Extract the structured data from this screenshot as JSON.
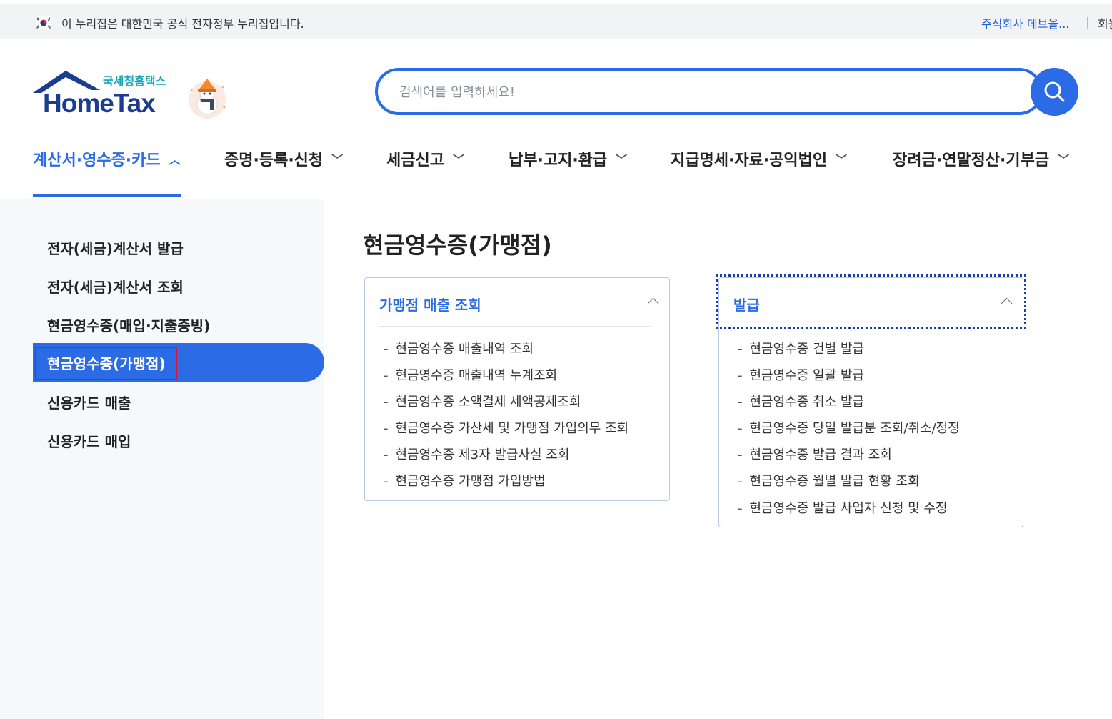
{
  "topbar": {
    "gov_notice": "이 누리집은 대한민국 공식 전자정부 누리집입니다.",
    "company": "주식회사 데브올...",
    "member": "회원"
  },
  "logo": {
    "sub": "국세청홈택스",
    "main": "HomeTax"
  },
  "search": {
    "placeholder": "검색어를 입력하세요!"
  },
  "gnb": [
    {
      "label": "계산서·영수증·카드",
      "active": true
    },
    {
      "label": "증명·등록·신청"
    },
    {
      "label": "세금신고"
    },
    {
      "label": "납부·고지·환급"
    },
    {
      "label": "지급명세·자료·공익법인"
    },
    {
      "label": "장려금·연말정산·기부금"
    }
  ],
  "sidebar": {
    "items": [
      "전자(세금)계산서 발급",
      "전자(세금)계산서 조회",
      "현금영수증(매입·지출증빙)",
      "현금영수증(가맹점)",
      "신용카드 매출",
      "신용카드 매입"
    ]
  },
  "page": {
    "title": "현금영수증(가맹점)"
  },
  "cards": [
    {
      "title": "가맹점 매출 조회",
      "links": [
        "현금영수증 매출내역 조회",
        "현금영수증 매출내역 누계조회",
        "현금영수증 소액결제 세액공제조회",
        "현금영수증 가산세 및 가맹점 가입의무 조회",
        "현금영수증 제3자 발급사실 조회",
        "현금영수증 가맹점 가입방법"
      ]
    },
    {
      "title": "발급",
      "links": [
        "현금영수증 건별 발급",
        "현금영수증 일괄 발급",
        "현금영수증 취소 발급",
        "현금영수증 당일 발급분 조회/취소/정정",
        "현금영수증 발급 결과 조회",
        "현금영수증 월별 발급 현황 조회",
        "현금영수증 발급 사업자 신청 및 수정"
      ]
    }
  ],
  "colors": {
    "primary": "#2b6be6",
    "logo_text": "#1b3d8f",
    "logo_sub": "#1aa6b7",
    "highlight": "#e0102a"
  }
}
